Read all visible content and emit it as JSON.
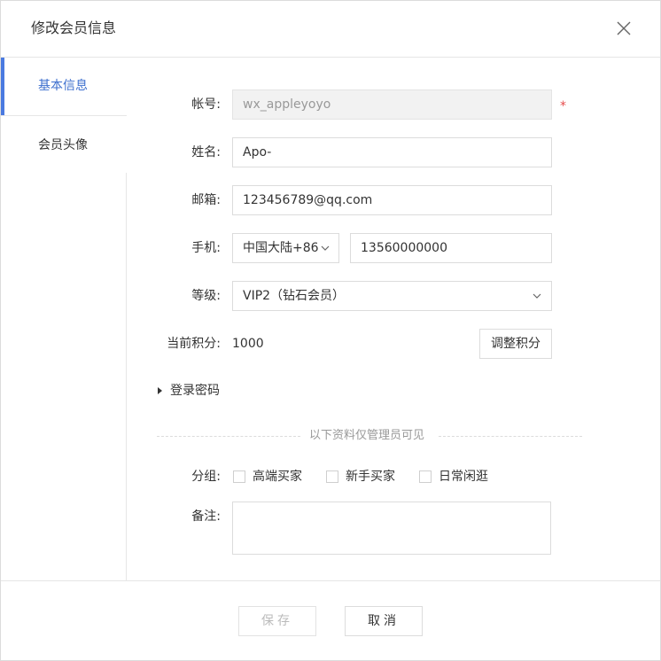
{
  "dialog": {
    "title": "修改会员信息"
  },
  "sidebar": {
    "items": [
      {
        "label": "基本信息"
      },
      {
        "label": "会员头像"
      }
    ]
  },
  "form": {
    "account": {
      "label": "帐号:",
      "value": "wx_appleyoyo",
      "required_mark": "*"
    },
    "name": {
      "label": "姓名:",
      "value": "Apo-"
    },
    "email": {
      "label": "邮箱:",
      "value": "123456789@qq.com"
    },
    "phone": {
      "label": "手机:",
      "region": "中国大陆+86",
      "number": "13560000000"
    },
    "level": {
      "label": "等级:",
      "value": "VIP2（钻石会员）"
    },
    "points": {
      "label": "当前积分:",
      "value": "1000",
      "adjust_button": "调整积分"
    },
    "password": {
      "label": "登录密码"
    },
    "admin_divider": "以下资料仅管理员可见",
    "group": {
      "label": "分组:",
      "options": [
        {
          "label": "高端买家",
          "checked": false
        },
        {
          "label": "新手买家",
          "checked": false
        },
        {
          "label": "日常闲逛",
          "checked": false
        }
      ]
    },
    "remark": {
      "label": "备注:",
      "value": ""
    }
  },
  "footer": {
    "save_label": "保存",
    "cancel_label": "取消"
  },
  "colors": {
    "accent": "#4a7ae0",
    "required": "#e64c4c"
  }
}
